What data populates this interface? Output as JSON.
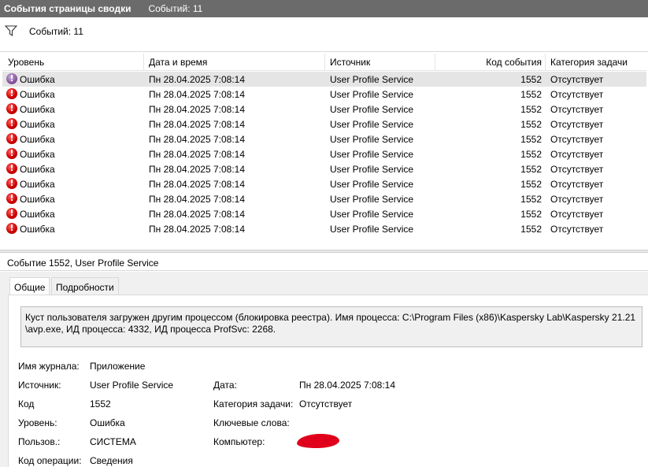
{
  "window": {
    "title": "События страницы сводки",
    "count_label": "Событий: 11"
  },
  "filter": {
    "icon": "filter-icon",
    "count_label": "Событий: 11"
  },
  "columns": [
    "Уровень",
    "Дата и время",
    "Источник",
    "Код события",
    "Категория задачи"
  ],
  "events": [
    {
      "level": "Ошибка",
      "datetime": "Пн 28.04.2025 7:08:14",
      "source": "User Profile Service",
      "code": "1552",
      "category": "Отсутствует"
    },
    {
      "level": "Ошибка",
      "datetime": "Пн 28.04.2025 7:08:14",
      "source": "User Profile Service",
      "code": "1552",
      "category": "Отсутствует"
    },
    {
      "level": "Ошибка",
      "datetime": "Пн 28.04.2025 7:08:14",
      "source": "User Profile Service",
      "code": "1552",
      "category": "Отсутствует"
    },
    {
      "level": "Ошибка",
      "datetime": "Пн 28.04.2025 7:08:14",
      "source": "User Profile Service",
      "code": "1552",
      "category": "Отсутствует"
    },
    {
      "level": "Ошибка",
      "datetime": "Пн 28.04.2025 7:08:14",
      "source": "User Profile Service",
      "code": "1552",
      "category": "Отсутствует"
    },
    {
      "level": "Ошибка",
      "datetime": "Пн 28.04.2025 7:08:14",
      "source": "User Profile Service",
      "code": "1552",
      "category": "Отсутствует"
    },
    {
      "level": "Ошибка",
      "datetime": "Пн 28.04.2025 7:08:14",
      "source": "User Profile Service",
      "code": "1552",
      "category": "Отсутствует"
    },
    {
      "level": "Ошибка",
      "datetime": "Пн 28.04.2025 7:08:14",
      "source": "User Profile Service",
      "code": "1552",
      "category": "Отсутствует"
    },
    {
      "level": "Ошибка",
      "datetime": "Пн 28.04.2025 7:08:14",
      "source": "User Profile Service",
      "code": "1552",
      "category": "Отсутствует"
    },
    {
      "level": "Ошибка",
      "datetime": "Пн 28.04.2025 7:08:14",
      "source": "User Profile Service",
      "code": "1552",
      "category": "Отсутствует"
    },
    {
      "level": "Ошибка",
      "datetime": "Пн 28.04.2025 7:08:14",
      "source": "User Profile Service",
      "code": "1552",
      "category": "Отсутствует"
    }
  ],
  "detail": {
    "title": "Событие 1552, User Profile Service",
    "tabs": [
      "Общие",
      "Подробности"
    ],
    "description": "Куст пользователя загружен другим процессом (блокировка реестра). Имя процесса: C:\\Program Files (x86)\\Kaspersky Lab\\Kaspersky 21.21\n\\avp.exe, ИД процесса: 4332, ИД процесса ProfSvc: 2268.",
    "fields": {
      "log_label": "Имя журнала:",
      "log_value": "Приложение",
      "source_label": "Источник:",
      "source_value": "User Profile Service",
      "date_label": "Дата:",
      "date_value": "Пн 28.04.2025 7:08:14",
      "code_label": "Код",
      "code_value": "1552",
      "category_label": "Категория задачи:",
      "category_value": "Отсутствует",
      "level_label": "Уровень:",
      "level_value": "Ошибка",
      "keywords_label": "Ключевые слова:",
      "user_label": "Пользов.:",
      "user_value": "СИСТЕМА",
      "computer_label": "Компьютер:",
      "opcode_label": "Код операции:",
      "opcode_value": "Сведения"
    }
  },
  "colors": {
    "titlebar": "#6b6b6b",
    "selected_row": "#e5e5e5",
    "error_icon": "#d10000",
    "redaction": "#e0001b"
  }
}
